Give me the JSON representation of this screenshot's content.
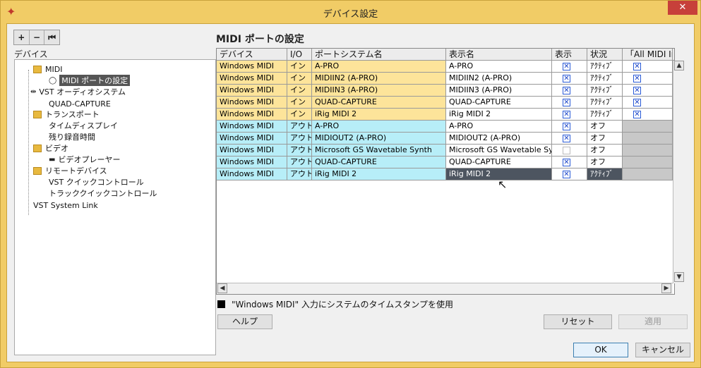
{
  "window": {
    "title": "デバイス設定",
    "close": "✕"
  },
  "tree": {
    "toolbar": [
      "+",
      "−",
      "⏮"
    ],
    "header": "デバイス",
    "items": [
      {
        "label": "MIDI",
        "level": 1,
        "folder": true
      },
      {
        "label": "MIDI ポートの設定",
        "level": 2,
        "selected": true,
        "icon": "midi-port-icon"
      },
      {
        "label": "VST オーディオシステム",
        "level": 1,
        "icon": "audio-icon"
      },
      {
        "label": "QUAD-CAPTURE",
        "level": 2
      },
      {
        "label": "トランスポート",
        "level": 1,
        "folder": true
      },
      {
        "label": "タイムディスプレイ",
        "level": 2
      },
      {
        "label": "残り録音時間",
        "level": 2
      },
      {
        "label": "ビデオ",
        "level": 1,
        "folder": true
      },
      {
        "label": "ビデオプレーヤー",
        "level": 2,
        "icon": "video-icon"
      },
      {
        "label": "リモートデバイス",
        "level": 1,
        "folder": true
      },
      {
        "label": "VST クイックコントロール",
        "level": 2
      },
      {
        "label": "トラッククイックコントロール",
        "level": 2
      },
      {
        "label": "VST System Link",
        "level": 1
      }
    ]
  },
  "panel": {
    "title": "MIDI ポートの設定"
  },
  "table": {
    "columns": [
      "デバイス",
      "I/O",
      "ポートシステム名",
      "表示名",
      "表示",
      "状況",
      "「All MIDI In"
    ],
    "rows": [
      {
        "device": "Windows MIDI",
        "io": "イン",
        "port": "A-PRO",
        "display": "A-PRO",
        "show": true,
        "status": "ｱｸﾃｨﾌﾞ",
        "all_midi": true,
        "kind": "in"
      },
      {
        "device": "Windows MIDI",
        "io": "イン",
        "port": "MIDIIN2 (A-PRO)",
        "display": "MIDIIN2 (A-PRO)",
        "show": true,
        "status": "ｱｸﾃｨﾌﾞ",
        "all_midi": true,
        "kind": "in"
      },
      {
        "device": "Windows MIDI",
        "io": "イン",
        "port": "MIDIIN3 (A-PRO)",
        "display": "MIDIIN3 (A-PRO)",
        "show": true,
        "status": "ｱｸﾃｨﾌﾞ",
        "all_midi": true,
        "kind": "in"
      },
      {
        "device": "Windows MIDI",
        "io": "イン",
        "port": "QUAD-CAPTURE",
        "display": "QUAD-CAPTURE",
        "show": true,
        "status": "ｱｸﾃｨﾌﾞ",
        "all_midi": true,
        "kind": "in"
      },
      {
        "device": "Windows MIDI",
        "io": "イン",
        "port": "iRig MIDI 2",
        "display": "iRig MIDI 2",
        "show": true,
        "status": "ｱｸﾃｨﾌﾞ",
        "all_midi": true,
        "kind": "in"
      },
      {
        "device": "Windows MIDI",
        "io": "アウト",
        "port": "A-PRO",
        "display": "A-PRO",
        "show": true,
        "status": "オフ",
        "all_midi": null,
        "kind": "out"
      },
      {
        "device": "Windows MIDI",
        "io": "アウト",
        "port": "MIDIOUT2 (A-PRO)",
        "display": "MIDIOUT2 (A-PRO)",
        "show": true,
        "status": "オフ",
        "all_midi": null,
        "kind": "out"
      },
      {
        "device": "Windows MIDI",
        "io": "アウト",
        "port": "Microsoft GS Wavetable Synth",
        "display": "Microsoft GS Wavetable Synth",
        "show": false,
        "status": "オフ",
        "all_midi": null,
        "kind": "out"
      },
      {
        "device": "Windows MIDI",
        "io": "アウト",
        "port": "QUAD-CAPTURE",
        "display": "QUAD-CAPTURE",
        "show": true,
        "status": "オフ",
        "all_midi": null,
        "kind": "out"
      },
      {
        "device": "Windows MIDI",
        "io": "アウト",
        "port": "iRig MIDI 2",
        "display": "iRig MIDI 2",
        "show": true,
        "status": "ｱｸﾃｨﾌﾞ",
        "all_midi": null,
        "kind": "out",
        "editing": true
      }
    ]
  },
  "timestamp_option": {
    "label": "\"Windows MIDI\" 入力にシステムのタイムスタンプを使用",
    "checked": true
  },
  "buttons": {
    "help": "ヘルプ",
    "reset": "リセット",
    "apply": "適用",
    "ok": "OK",
    "cancel": "キャンセル"
  },
  "colors": {
    "title_bar": "#f1cc66",
    "in_row": "#fde49a",
    "out_row": "#b7eef8"
  }
}
